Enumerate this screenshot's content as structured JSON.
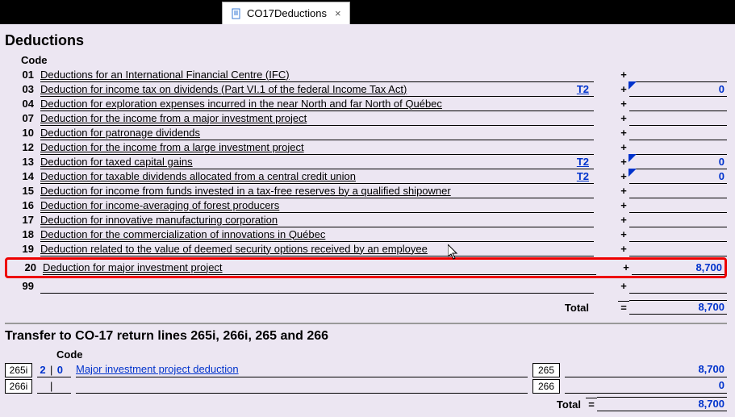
{
  "tab": {
    "label": "CO17Deductions",
    "close": "×"
  },
  "heading": "Deductions",
  "code_header": "Code",
  "t2_label": "T2",
  "plus": "+",
  "eq": "=",
  "total_label": "Total",
  "rows": [
    {
      "code": "01",
      "desc": "Deductions for an International Financial Centre (IFC)",
      "t2": "",
      "value": ""
    },
    {
      "code": "03",
      "desc": "Deduction for income tax on dividends (Part VI.1 of the federal Income Tax Act)",
      "t2": "T2",
      "value": "0"
    },
    {
      "code": "04",
      "desc": "Deduction for exploration expenses incurred in the near North and far North of Québec",
      "t2": "",
      "value": ""
    },
    {
      "code": "07",
      "desc": "Deduction for the income from a major investment project",
      "t2": "",
      "value": ""
    },
    {
      "code": "10",
      "desc": "Deduction for patronage dividends",
      "t2": "",
      "value": ""
    },
    {
      "code": "12",
      "desc": "Deduction for the income from a large investment project",
      "t2": "",
      "value": ""
    },
    {
      "code": "13",
      "desc": "Deduction for taxed capital gains",
      "t2": "T2",
      "value": "0"
    },
    {
      "code": "14",
      "desc": "Deduction for taxable dividends allocated from a central credit union",
      "t2": "T2",
      "value": "0"
    },
    {
      "code": "15",
      "desc": "Deduction for income from funds invested in a tax-free reserves by a qualified shipowner",
      "t2": "",
      "value": ""
    },
    {
      "code": "16",
      "desc": "Deduction for income-averaging of forest producers",
      "t2": "",
      "value": ""
    },
    {
      "code": "17",
      "desc": "Deduction for innovative manufacturing corporation",
      "t2": "",
      "value": ""
    },
    {
      "code": "18",
      "desc": "Deduction for the commercialization of innovations in Québec",
      "t2": "",
      "value": ""
    },
    {
      "code": "19",
      "desc": "Deduction related to the value of deemed security options received by an employee",
      "t2": "",
      "value": ""
    }
  ],
  "row20": {
    "code": "20",
    "desc": "Deduction for major investment project",
    "value": "8,700"
  },
  "row99": {
    "code": "99",
    "desc": "",
    "value": ""
  },
  "total_value": "8,700",
  "transfer_heading": "Transfer to CO-17 return lines 265i, 266i, 265 and 266",
  "tx": {
    "code_header": "Code",
    "lines": [
      {
        "left_label": "265i",
        "code_d1": "2",
        "code_d2": "0",
        "desc": "Major investment project deduction",
        "right_label": "265",
        "value": "8,700"
      },
      {
        "left_label": "266i",
        "code_d1": "",
        "code_d2": "",
        "desc": "",
        "right_label": "266",
        "value": "0"
      }
    ],
    "total_label": "Total",
    "total_value": "8,700"
  }
}
